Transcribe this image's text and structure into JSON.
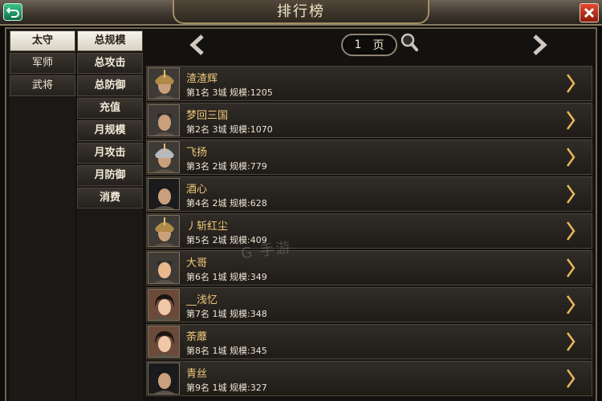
{
  "header": {
    "title": "排行榜"
  },
  "categories": [
    {
      "label": "太守",
      "active": true
    },
    {
      "label": "军师",
      "active": false
    },
    {
      "label": "武将",
      "active": false
    }
  ],
  "subcategories": [
    {
      "label": "总规模",
      "active": true
    },
    {
      "label": "总攻击",
      "active": false
    },
    {
      "label": "总防御",
      "active": false
    },
    {
      "label": "充值",
      "active": false
    },
    {
      "label": "月规模",
      "active": false
    },
    {
      "label": "月攻击",
      "active": false
    },
    {
      "label": "月防御",
      "active": false
    },
    {
      "label": "消费",
      "active": false
    }
  ],
  "pager": {
    "page": "1",
    "unit": "页"
  },
  "rankings": [
    {
      "name": "渣渣辉",
      "detail": "第1名 3城 规模:1205",
      "avatar": "helmet-warrior-icon"
    },
    {
      "name": "梦回三国",
      "detail": "第2名 3城 规模:1070",
      "avatar": "warrior-portrait-icon"
    },
    {
      "name": "飞扬",
      "detail": "第3名 2城 规模:779",
      "avatar": "silver-helmet-icon"
    },
    {
      "name": "酒心",
      "detail": "第4名 2城 规模:628",
      "avatar": "dark-warrior-icon"
    },
    {
      "name": "丿斩红尘",
      "detail": "第5名 2城 规模:409",
      "avatar": "helmet-warrior-icon"
    },
    {
      "name": "大哥",
      "detail": "第6名 1城 规模:349",
      "avatar": "scholar-portrait-icon"
    },
    {
      "name": "__浅忆",
      "detail": "第7名 1城 规模:348",
      "avatar": "lady-portrait-icon"
    },
    {
      "name": "荼蘼",
      "detail": "第8名 1城 规模:345",
      "avatar": "lady-portrait-icon"
    },
    {
      "name": "青丝",
      "detail": "第9名 1城 规模:327",
      "avatar": "dark-warrior-icon"
    }
  ],
  "watermark": "G 手游",
  "colors": {
    "accent_name": "#f1c97a",
    "frame": "#6e634e",
    "back": "#1f9c64",
    "close": "#c0301c"
  }
}
